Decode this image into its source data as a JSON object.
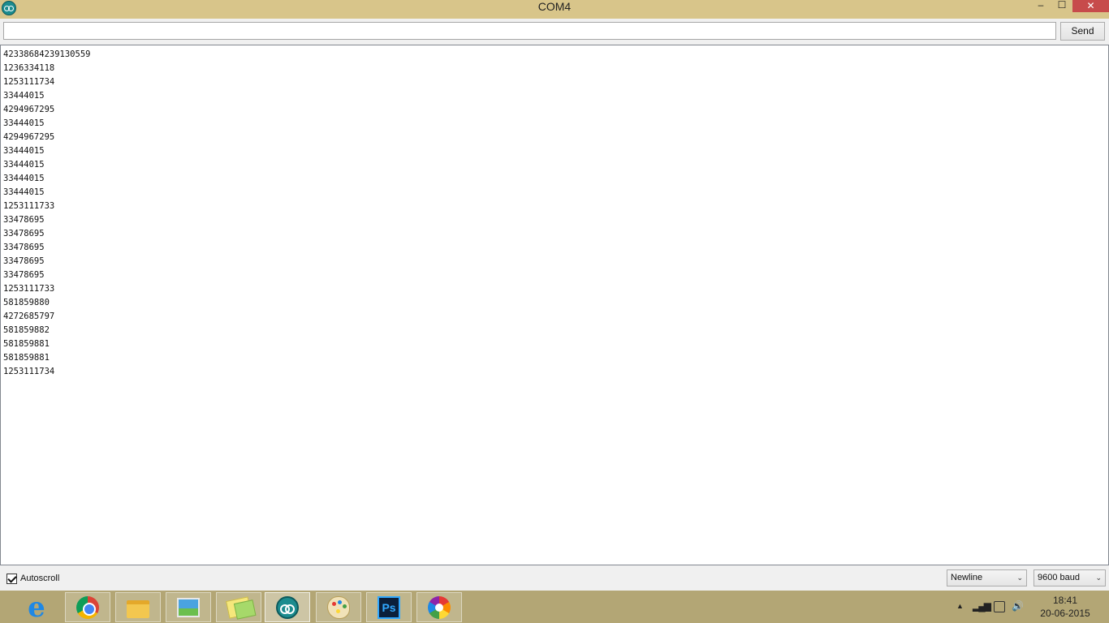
{
  "window": {
    "title": "COM4",
    "min_label": "–",
    "max_label": "☐",
    "close_label": "✕"
  },
  "send_bar": {
    "input_value": "",
    "send_label": "Send"
  },
  "output_lines": [
    "42338684239130559",
    "1236334118",
    "1253111734",
    "33444015",
    "4294967295",
    "33444015",
    "4294967295",
    "33444015",
    "33444015",
    "33444015",
    "33444015",
    "1253111733",
    "33478695",
    "33478695",
    "33478695",
    "33478695",
    "33478695",
    "1253111733",
    "581859880",
    "4272685797",
    "581859882",
    "581859881",
    "581859881",
    "1253111734"
  ],
  "bottom_bar": {
    "autoscroll_label": "Autoscroll",
    "autoscroll_checked": true,
    "line_ending": "Newline",
    "baud_rate": "9600 baud"
  },
  "taskbar": {
    "apps": [
      {
        "name": "internet-explorer",
        "icon": "ie-icon"
      },
      {
        "name": "chrome",
        "icon": "chrome-icon"
      },
      {
        "name": "file-explorer",
        "icon": "folder-icon"
      },
      {
        "name": "photos",
        "icon": "photo-icon"
      },
      {
        "name": "sticky-notes",
        "icon": "notes-icon"
      },
      {
        "name": "arduino",
        "icon": "arduino-icon"
      },
      {
        "name": "paint",
        "icon": "paint-icon"
      },
      {
        "name": "photoshop",
        "icon": "photoshop-icon",
        "label": "Ps"
      },
      {
        "name": "picasa",
        "icon": "picasa-icon"
      }
    ],
    "tray": {
      "show_hidden": "▲",
      "signal": "▂▄▆",
      "volume": "🔊",
      "time": "18:41",
      "date": "20-06-2015"
    }
  }
}
